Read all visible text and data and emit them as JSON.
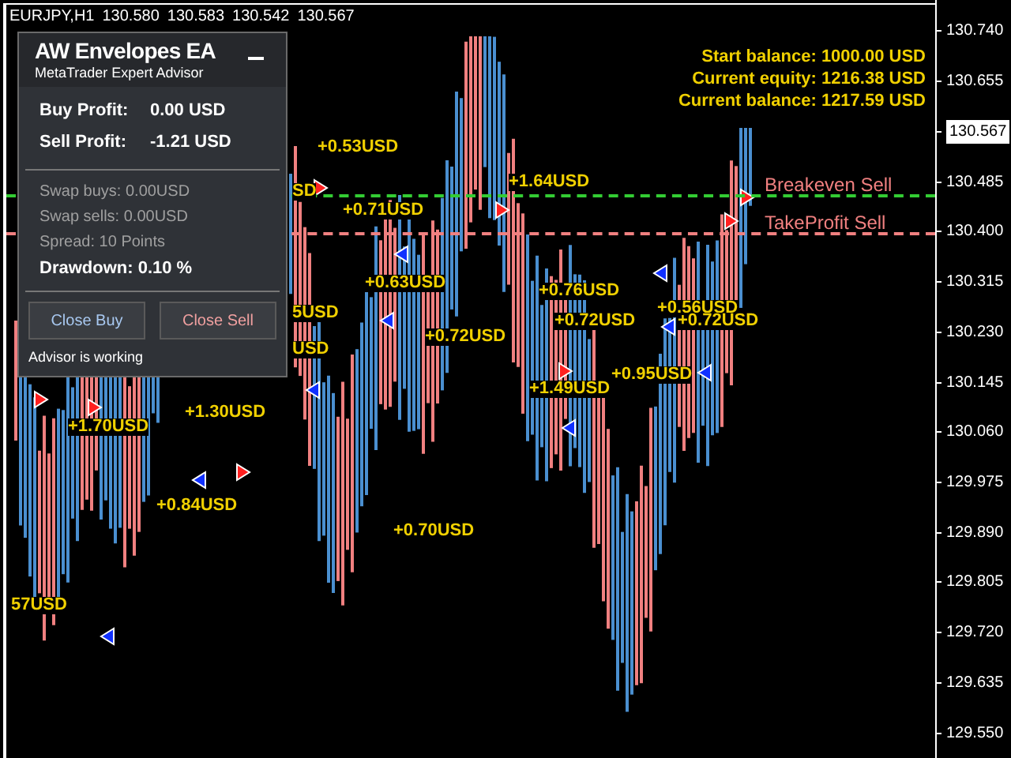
{
  "symbol_bar": {
    "symbol": "EURJPY,H1",
    "quotes": [
      "130.580",
      "130.583",
      "130.542",
      "130.567"
    ]
  },
  "panel": {
    "title": "AW Envelopes EA",
    "subtitle": "MetaTrader Expert Advisor",
    "profits": [
      {
        "label": "Buy Profit:",
        "value": "0.00 USD"
      },
      {
        "label": "Sell Profit:",
        "value": "-1.21 USD"
      }
    ],
    "stats": [
      {
        "text": "Swap buys: 0.00USD",
        "bold": false
      },
      {
        "text": "Swap sells: 0.00USD",
        "bold": false
      },
      {
        "text": "Spread: 10 Points",
        "bold": false
      },
      {
        "text": "Drawdown: 0.10 %",
        "bold": true
      }
    ],
    "buttons": [
      {
        "label": "Close Buy",
        "kind": "buy"
      },
      {
        "label": "Close Sell",
        "kind": "sell"
      }
    ],
    "status": "Advisor is working"
  },
  "balances": [
    "Start balance: 1000.00 USD",
    "Current equity: 1216.38 USD",
    "Current balance: 1217.59 USD"
  ],
  "level_lines": [
    {
      "label": "Breakeven Sell",
      "kind": "breakeven"
    },
    {
      "label": "TakeProfit Sell",
      "kind": "takeprofit"
    }
  ],
  "trade_labels": [
    "+0.53USD",
    "SD",
    "+1.64USD",
    "+0.71USD",
    "+0.63USD",
    "+0.76USD",
    "5USD",
    "+0.72USD",
    "+0.72USD",
    "+0.56USD",
    "+0.72USD",
    "USD",
    "+1.49USD",
    "+0.95USD",
    "+1.70USD",
    "+1.30USD",
    "+0.84USD",
    "+0.70USD",
    "57USD"
  ],
  "price_axis": [
    {
      "value": "130.740",
      "kind": "tick"
    },
    {
      "value": "130.655",
      "kind": "tick"
    },
    {
      "value": "130.567",
      "kind": "current"
    },
    {
      "value": "130.485",
      "kind": "tick"
    },
    {
      "value": "130.400",
      "kind": "tick"
    },
    {
      "value": "130.315",
      "kind": "tick"
    },
    {
      "value": "130.230",
      "kind": "tick"
    },
    {
      "value": "130.145",
      "kind": "tick"
    },
    {
      "value": "130.060",
      "kind": "tick"
    },
    {
      "value": "129.975",
      "kind": "tick"
    },
    {
      "value": "129.890",
      "kind": "tick"
    },
    {
      "value": "129.805",
      "kind": "tick"
    },
    {
      "value": "129.720",
      "kind": "tick"
    },
    {
      "value": "129.635",
      "kind": "tick"
    },
    {
      "value": "129.550",
      "kind": "tick"
    }
  ]
}
